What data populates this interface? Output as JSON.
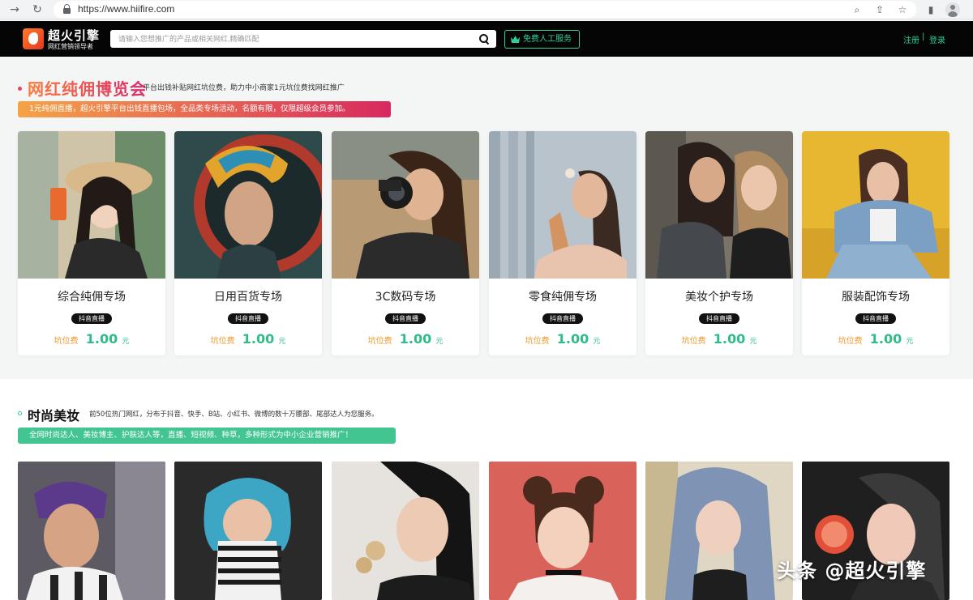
{
  "browser": {
    "url": "https://www.hiifire.com"
  },
  "header": {
    "logo_title": "超火引擎",
    "logo_subtitle": "网红营销领导者",
    "search_placeholder": "请输入您想推广的产品或相关网红,精确匹配",
    "service_button": "免费人工服务",
    "register": "注册",
    "separator": "|",
    "login": "登录",
    "accent_color": "#2ecf95"
  },
  "section1": {
    "title": "网红纯佣博览会",
    "subtitle": "平台出钱补贴网红坑位费，助力中小商家1元坑位费找网红推广",
    "banner": "1元纯佣直播，超火引擎平台出钱直播包场，全品类专场活动，名额有限，仅限超级会员参加。",
    "cards": [
      {
        "title": "综合纯佣专场",
        "tag": "抖音直播",
        "price_label": "坑位费",
        "price": "1.00",
        "unit": "元"
      },
      {
        "title": "日用百货专场",
        "tag": "抖音直播",
        "price_label": "坑位费",
        "price": "1.00",
        "unit": "元"
      },
      {
        "title": "3C数码专场",
        "tag": "抖音直播",
        "price_label": "坑位费",
        "price": "1.00",
        "unit": "元"
      },
      {
        "title": "零食纯佣专场",
        "tag": "抖音直播",
        "price_label": "坑位费",
        "price": "1.00",
        "unit": "元"
      },
      {
        "title": "美妆个护专场",
        "tag": "抖音直播",
        "price_label": "坑位费",
        "price": "1.00",
        "unit": "元"
      },
      {
        "title": "服装配饰专场",
        "tag": "抖音直播",
        "price_label": "坑位费",
        "price": "1.00",
        "unit": "元"
      }
    ]
  },
  "section2": {
    "title": "时尚美妆",
    "subtitle": "前50位热门网红，分布于抖音、快手、B站、小红书、微博的数十万腰部、尾部达人为您服务。",
    "banner": "全网时尚达人、美妆博主、护肤达人等，直播、短视频、种草，多种形式为中小企业营销推广！"
  },
  "watermark": "头条 @超火引擎"
}
